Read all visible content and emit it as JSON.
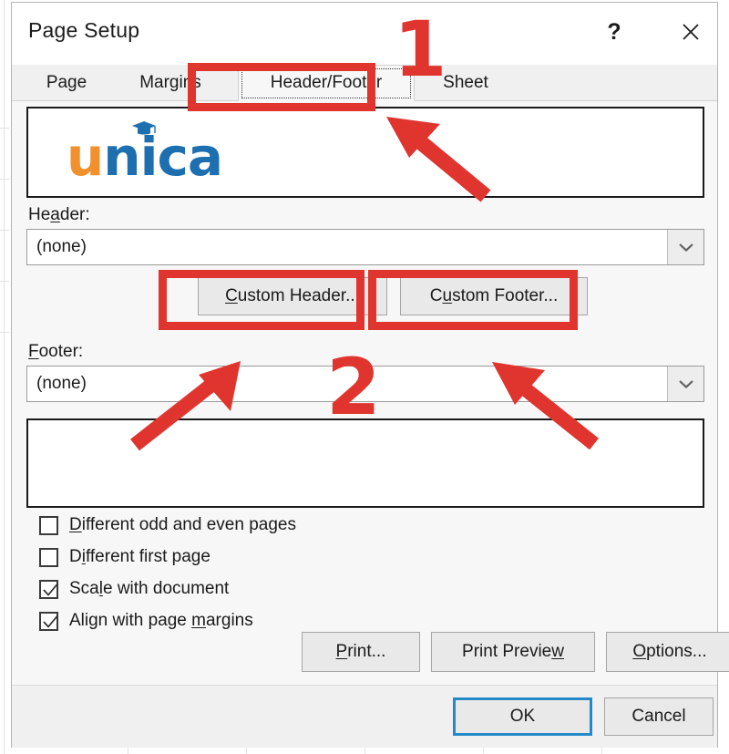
{
  "window": {
    "title": "Page Setup",
    "help_icon": "question-mark-icon",
    "close_icon": "close-x-icon"
  },
  "tabs": [
    {
      "id": "page",
      "label": "Page",
      "selected": false
    },
    {
      "id": "margins",
      "label": "Margins",
      "selected": false
    },
    {
      "id": "header-footer",
      "label": "Header/Footer",
      "selected": true
    },
    {
      "id": "sheet",
      "label": "Sheet",
      "selected": false
    }
  ],
  "header_preview": {
    "logo_text_primary": "u",
    "logo_text_secondary": "nica",
    "logo_primary_color": "#F0912E",
    "logo_secondary_color": "#1E6FAF",
    "cap_icon": "graduation-cap-icon"
  },
  "footer_preview": {
    "content": ""
  },
  "header_field": {
    "label_pre": "He",
    "label_accel": "a",
    "label_post": "der:",
    "value": "(none)",
    "arrow_icon": "chevron-down-icon"
  },
  "footer_field": {
    "label_pre": "",
    "label_accel": "F",
    "label_post": "ooter:",
    "value": "(none)",
    "arrow_icon": "chevron-down-icon"
  },
  "custom_buttons": {
    "header": {
      "pre": "",
      "accel": "C",
      "post": "ustom Header..."
    },
    "footer": {
      "pre": "C",
      "accel": "u",
      "post": "stom Footer..."
    }
  },
  "checkboxes": [
    {
      "id": "different-odd-even",
      "pre": "",
      "accel": "D",
      "post": "ifferent odd and even pages",
      "checked": false
    },
    {
      "id": "different-first",
      "pre": "D",
      "accel": "i",
      "post": "fferent first page",
      "checked": false
    },
    {
      "id": "scale-with-doc",
      "pre": "Sca",
      "accel": "l",
      "post": "e with document",
      "checked": true
    },
    {
      "id": "align-with-margins",
      "pre": "Align with page ",
      "accel": "m",
      "post": "argins",
      "checked": true
    }
  ],
  "action_buttons": [
    {
      "id": "print",
      "pre": "",
      "accel": "P",
      "post": "rint..."
    },
    {
      "id": "print-preview",
      "pre": "Print Previe",
      "accel": "w",
      "post": ""
    },
    {
      "id": "options",
      "pre": "",
      "accel": "O",
      "post": "ptions..."
    }
  ],
  "dialog_buttons": {
    "ok": "OK",
    "cancel": "Cancel",
    "ok_focus_color": "#2489C8"
  },
  "annotations": {
    "color": "#E0352F",
    "step_one": "1",
    "step_two": "2",
    "highlights": [
      "header-footer-tab",
      "custom-header-button",
      "custom-footer-button"
    ],
    "arrows": [
      "arrow-to-header-footer-tab",
      "arrow-to-custom-header-button",
      "arrow-to-custom-footer-button"
    ]
  }
}
